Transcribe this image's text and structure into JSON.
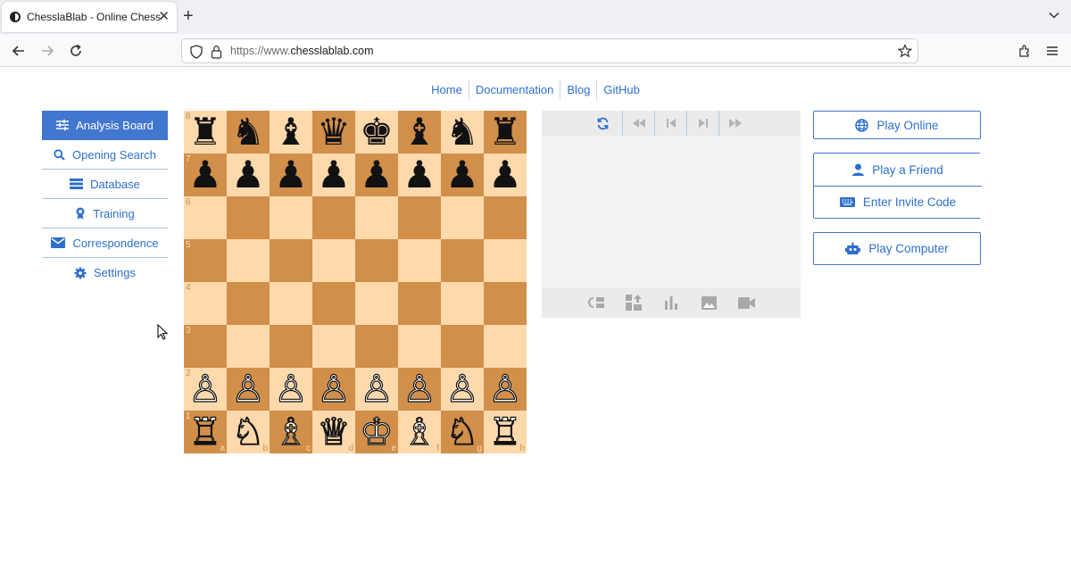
{
  "browser": {
    "tab_title": "ChesslaBlab - Online Chess",
    "url_prefix": "https://www.",
    "url_host": "chesslablab.com"
  },
  "topnav": [
    "Home",
    "Documentation",
    "Blog",
    "GitHub"
  ],
  "sidebar": [
    {
      "label": "Analysis Board",
      "icon": "sliders-icon",
      "active": true
    },
    {
      "label": "Opening Search",
      "icon": "search-icon",
      "active": false
    },
    {
      "label": "Database",
      "icon": "database-icon",
      "active": false
    },
    {
      "label": "Training",
      "icon": "award-icon",
      "active": false
    },
    {
      "label": "Correspondence",
      "icon": "mail-icon",
      "active": false
    },
    {
      "label": "Settings",
      "icon": "gear-icon",
      "active": false
    }
  ],
  "board": {
    "ranks": [
      "8",
      "7",
      "6",
      "5",
      "4",
      "3",
      "2",
      "1"
    ],
    "files": [
      "a",
      "b",
      "c",
      "d",
      "e",
      "f",
      "g",
      "h"
    ],
    "rows": [
      [
        "♜",
        "♞",
        "♝",
        "♛",
        "♚",
        "♝",
        "♞",
        "♜"
      ],
      [
        "♟",
        "♟",
        "♟",
        "♟",
        "♟",
        "♟",
        "♟",
        "♟"
      ],
      [
        "",
        "",
        "",
        "",
        "",
        "",
        "",
        ""
      ],
      [
        "",
        "",
        "",
        "",
        "",
        "",
        "",
        ""
      ],
      [
        "",
        "",
        "",
        "",
        "",
        "",
        "",
        ""
      ],
      [
        "",
        "",
        "",
        "",
        "",
        "",
        "",
        ""
      ],
      [
        "♙",
        "♙",
        "♙",
        "♙",
        "♙",
        "♙",
        "♙",
        "♙"
      ],
      [
        "♖",
        "♘",
        "♗",
        "♕",
        "♔",
        "♗",
        "♘",
        "♖"
      ]
    ],
    "colors": {
      "light": "#fdd9ac",
      "dark": "#d18f4a"
    }
  },
  "panel": {
    "top_controls": [
      "flip-icon",
      "rewind-icon",
      "first-move-icon",
      "last-move-icon",
      "fast-forward-icon"
    ],
    "bottom_tools": [
      "copy-fen-icon",
      "heuristics-icon",
      "chart-icon",
      "image-icon",
      "video-icon"
    ]
  },
  "right": {
    "play_online": "Play Online",
    "play_friend": "Play a Friend",
    "invite_code": "Enter Invite Code",
    "play_computer": "Play Computer"
  },
  "theme": {
    "accent": "#2d6fcf",
    "active_bg": "#4277cf"
  }
}
